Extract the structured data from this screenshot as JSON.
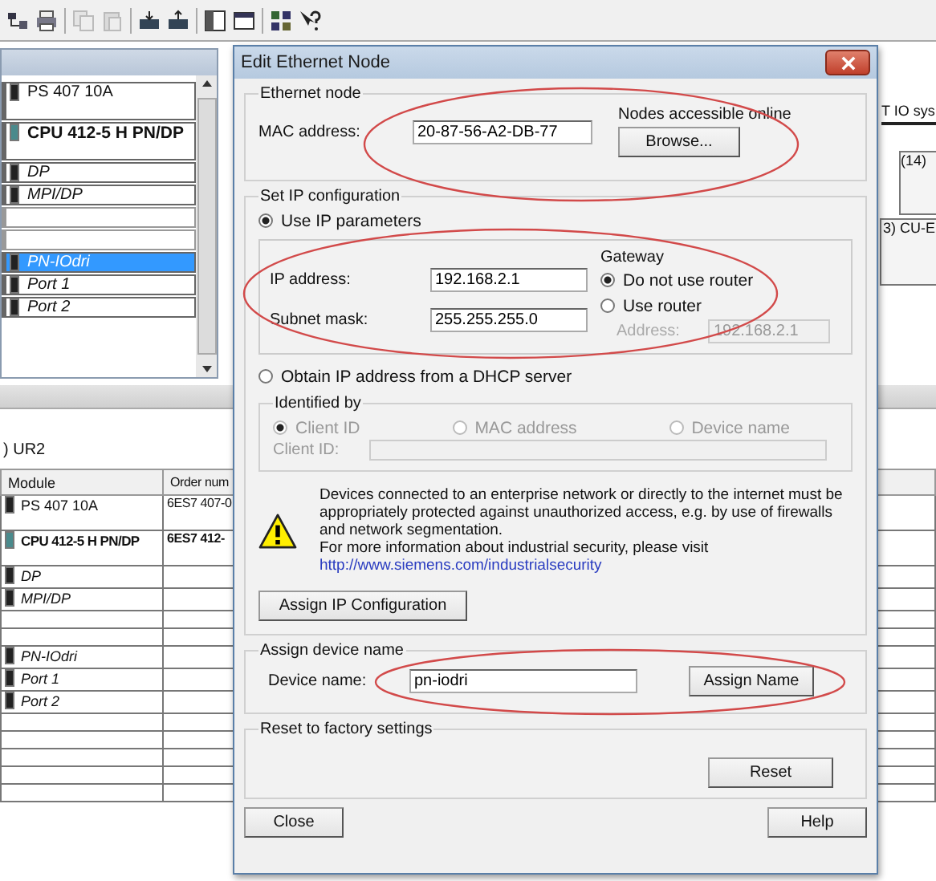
{
  "rack": {
    "rows": [
      {
        "module": "PS 407 10A",
        "kind": "module",
        "selected": false
      },
      {
        "module": "CPU 412-5 H PN/DP",
        "kind": "cpu",
        "selected": false
      },
      {
        "module": "DP",
        "kind": "interface",
        "selected": false
      },
      {
        "module": "MPI/DP",
        "kind": "interface",
        "selected": false
      },
      {
        "module": "",
        "kind": "empty",
        "selected": false
      },
      {
        "module": "",
        "kind": "empty",
        "selected": false
      },
      {
        "module": "PN-IOdri",
        "kind": "interface",
        "selected": true
      },
      {
        "module": "Port 1",
        "kind": "interface",
        "selected": false
      },
      {
        "module": "Port 2",
        "kind": "interface",
        "selected": false
      }
    ]
  },
  "diagram": {
    "network_label": "T IO sys",
    "nodes": [
      {
        "label": "(14)"
      },
      {
        "label": "3) CU-E"
      }
    ]
  },
  "table": {
    "station": ") UR2",
    "columns": [
      "Module",
      "Order num"
    ],
    "rows": [
      {
        "module": "PS 407 10A",
        "order": "6ES7 407-0",
        "kind": "module"
      },
      {
        "module": "CPU 412-5 H PN/DP",
        "order": "6ES7 412-",
        "kind": "cpu"
      },
      {
        "module": "DP",
        "order": "",
        "kind": "interface"
      },
      {
        "module": "MPI/DP",
        "order": "",
        "kind": "interface"
      },
      {
        "module": "",
        "order": "",
        "kind": "empty"
      },
      {
        "module": "",
        "order": "",
        "kind": "empty"
      },
      {
        "module": "PN-IOdri",
        "order": "",
        "kind": "interface"
      },
      {
        "module": "Port 1",
        "order": "",
        "kind": "interface"
      },
      {
        "module": "Port 2",
        "order": "",
        "kind": "interface"
      }
    ]
  },
  "dialog": {
    "title": "Edit Ethernet Node",
    "ethernet_node": {
      "legend": "Ethernet node",
      "mac_label": "MAC address:",
      "mac_value": "20-87-56-A2-DB-77",
      "online_label": "Nodes accessible online",
      "browse_button": "Browse..."
    },
    "ip_config": {
      "legend": "Set IP configuration",
      "use_ip": {
        "label": "Use IP parameters",
        "selected": true
      },
      "ip_label": "IP address:",
      "ip_value": "192.168.2.1",
      "mask_label": "Subnet mask:",
      "mask_value": "255.255.255.0",
      "gateway": {
        "title": "Gateway",
        "options": [
          {
            "label": "Do not use router",
            "selected": true
          },
          {
            "label": "Use router",
            "selected": false
          }
        ],
        "address_label": "Address:",
        "address_value": "192.168.2.1",
        "disabled": true
      },
      "dhcp": {
        "label": "Obtain IP address from a DHCP server",
        "selected": false
      },
      "identified_by": {
        "legend": "Identified by",
        "disabled": true,
        "options": [
          {
            "label": "Client ID",
            "selected": true
          },
          {
            "label": "MAC address",
            "selected": false
          },
          {
            "label": "Device name",
            "selected": false
          }
        ],
        "client_id_label": "Client ID:"
      },
      "warning": {
        "text": "Devices connected to an enterprise network or directly to the internet must be appropriately protected against unauthorized access, e.g. by use of firewalls and network segmentation.",
        "more_info": "For more information about industrial security, please visit",
        "link": "http://www.siemens.com/industrialsecurity"
      },
      "assign_button": "Assign IP Configuration"
    },
    "device_name": {
      "legend": "Assign device name",
      "label": "Device name:",
      "value": "pn-iodri",
      "button": "Assign Name"
    },
    "reset": {
      "legend": "Reset to factory settings",
      "button": "Reset"
    },
    "close_button": "Close",
    "help_button": "Help"
  }
}
